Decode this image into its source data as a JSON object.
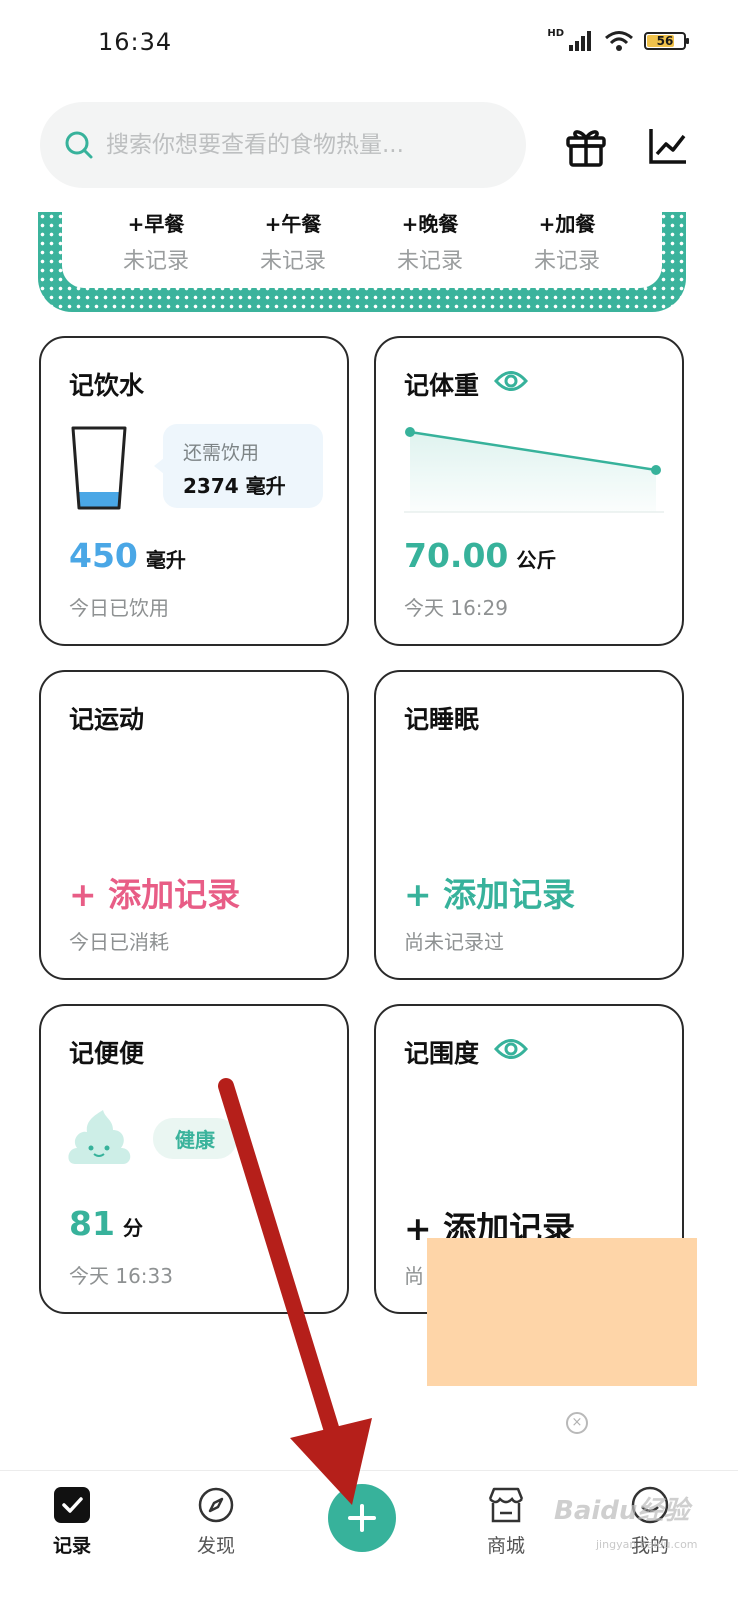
{
  "status": {
    "time": "16:34",
    "network": "HD",
    "battery": "56"
  },
  "search": {
    "placeholder": "搜索你想要查看的食物热量..."
  },
  "meals": [
    {
      "name": "+早餐",
      "status": "未记录"
    },
    {
      "name": "+午餐",
      "status": "未记录"
    },
    {
      "name": "+晚餐",
      "status": "未记录"
    },
    {
      "name": "+加餐",
      "status": "未记录"
    }
  ],
  "water": {
    "title": "记饮水",
    "remain_label": "还需饮用",
    "remain_value": "2374 毫升",
    "amount": "450",
    "unit": "毫升",
    "caption": "今日已饮用",
    "fill_fraction": 0.2
  },
  "weight": {
    "title": "记体重",
    "value": "70.00",
    "unit": "公斤",
    "caption": "今天 16:29"
  },
  "exercise": {
    "title": "记运动",
    "add": "+ 添加记录",
    "caption": "今日已消耗"
  },
  "sleep": {
    "title": "记睡眠",
    "add": "+ 添加记录",
    "caption": "尚未记录过"
  },
  "stool": {
    "title": "记便便",
    "badge": "健康",
    "score": "81",
    "unit": "分",
    "caption": "今天 16:33"
  },
  "girth": {
    "title": "记围度",
    "add": "+ 添加记录",
    "caption": "尚"
  },
  "tabs": [
    {
      "label": "记录"
    },
    {
      "label": "发现"
    },
    {
      "label": "商城"
    },
    {
      "label": "我的"
    }
  ],
  "watermark": {
    "text": "Baidu经验",
    "url": "jingyan.baidu.com"
  },
  "colors": {
    "accent": "#37b29b",
    "water": "#4aa7e6",
    "pink": "#e85d86",
    "ad": "#fed5a8",
    "arrow": "#b51f1a"
  }
}
